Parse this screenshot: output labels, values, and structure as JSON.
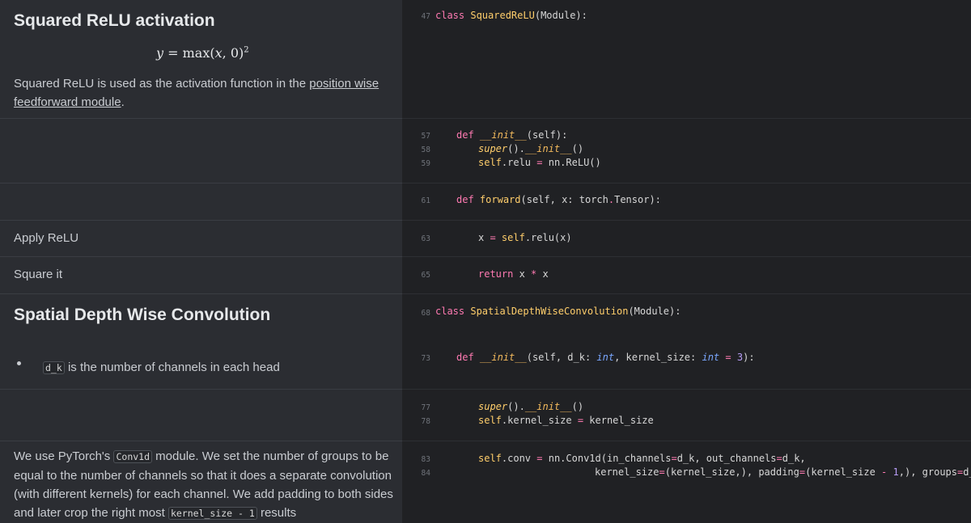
{
  "sections": {
    "s1": {
      "heading": "Squared ReLU activation",
      "math": {
        "lhs": "y",
        "eq": " = max(",
        "var": "x",
        "rest": ", 0)",
        "exp": "2"
      },
      "text_before": "Squared ReLU is used as the activation function in the ",
      "link1": "position wise",
      "link2": "feedforward module",
      "text_after": "."
    },
    "s4": {
      "text": "Apply ReLU"
    },
    "s5": {
      "text": "Square it"
    },
    "s6": {
      "heading": "Spatial Depth Wise Convolution"
    },
    "s7": {
      "code_inline": "d_k",
      "text": " is the number of channels in each head"
    },
    "s9": {
      "l1_a": "We use PyTorch's ",
      "l1_code": "Conv1d",
      "l1_b": " module. We set the number of groups to be",
      "l2": "equal to the number of channels so that it does a separate convolution",
      "l3": "(with different kernels) for each channel. We add padding to both sides",
      "l4_a": "and later crop the right most ",
      "l4_code": "kernel_size - 1",
      "l4_b": " results"
    }
  },
  "code": {
    "line_numbers": [
      "47",
      "57",
      "58",
      "59",
      "61",
      "63",
      "65",
      "68",
      "73",
      "77",
      "78",
      "83",
      "84"
    ],
    "l47": {
      "kw": "class",
      "name": "SquaredReLU",
      "rest": "(Module):"
    },
    "l57": {
      "kw": "def",
      "name": "__init__",
      "rest": "(self):"
    },
    "l58": {
      "sup": "super",
      "p1": "().",
      "init": "__init__",
      "p2": "()"
    },
    "l59": {
      "self": "self",
      "a": ".relu ",
      "eq": "=",
      "b": " nn.ReLU()"
    },
    "l61": {
      "kw": "def",
      "name": "forward",
      "a": "(self, x: torch",
      "dot": ".",
      "b": "Tensor):"
    },
    "l63": {
      "a": "x ",
      "eq": "=",
      "self": " self",
      "b": ".relu(x)"
    },
    "l65": {
      "kw": "return",
      "a": " x ",
      "op": "*",
      "b": " x"
    },
    "l68": {
      "kw": "class",
      "name": "SpatialDepthWiseConvolution",
      "rest": "(Module):"
    },
    "l73": {
      "kw": "def",
      "name": "__init__",
      "a": "(self, d_k: ",
      "t1": "int",
      "b": ", kernel_size: ",
      "t2": "int",
      "eq": " = ",
      "num": "3",
      "c": "):"
    },
    "l77": {
      "sup": "super",
      "p1": "().",
      "init": "__init__",
      "p2": "()"
    },
    "l78": {
      "self": "self",
      "a": ".kernel_size ",
      "eq": "=",
      "b": " kernel_size"
    },
    "l83": {
      "self": "self",
      "a": ".conv ",
      "eq": "=",
      "b": " nn.Conv1d(in_channels",
      "eq2": "=",
      "c": "d_k, out_channels",
      "eq3": "=",
      "d": "d_k,"
    },
    "l84": {
      "a": "kernel_size",
      "eq": "=",
      "b": "(kernel_size,), padding",
      "eq2": "=",
      "c": "(kernel_size ",
      "op": "-",
      "d": " ",
      "num": "1",
      "e": ",), groups",
      "eq3": "=",
      "f": "d_k)"
    }
  }
}
